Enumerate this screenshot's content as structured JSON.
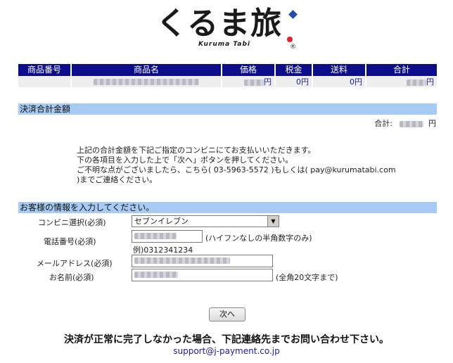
{
  "logo": {
    "main": "くるま旅",
    "sub": "Kuruma Tabi",
    "reg": "®"
  },
  "items_table": {
    "headers": [
      "商品番号",
      "商品名",
      "価格",
      "税金",
      "送料",
      "合計"
    ],
    "row": {
      "price_suffix": "円",
      "tax": "0円",
      "shipping": "0円",
      "total_suffix": "円"
    }
  },
  "payment_total": {
    "section_title": "決済合計金額",
    "label": "合計:",
    "suffix": "円"
  },
  "notice": {
    "lines": [
      "上記の合計金額を下記ご指定のコンビニにてお支払いいただきます。",
      "下の各項目を入力した上で「次へ」ボタンを押してください。",
      "ご不明な点がございましたら、こちら( 03-5963-5572 )もしくは( pay@kurumatabi.com",
      ")までご連絡ください。"
    ]
  },
  "customer": {
    "section_title": "お客様の情報を入力してください。",
    "store_label": "コンビニ選択(必須)",
    "store_selected": "セブンイレブン",
    "phone_label": "電話番号(必須)",
    "phone_hint": "(ハイフンなしの半角数字のみ)",
    "phone_example": "例)0312341234",
    "email_label": "メールアドレス(必須)",
    "name_label": "お名前(必須)",
    "name_hint": "(全角20文字まで)"
  },
  "next_button": "次へ",
  "footer": {
    "note": "決済が正常に完了しなかった場合、下記連絡先までお問い合わせ下さい。",
    "email": "support@j-payment.co.jp"
  }
}
